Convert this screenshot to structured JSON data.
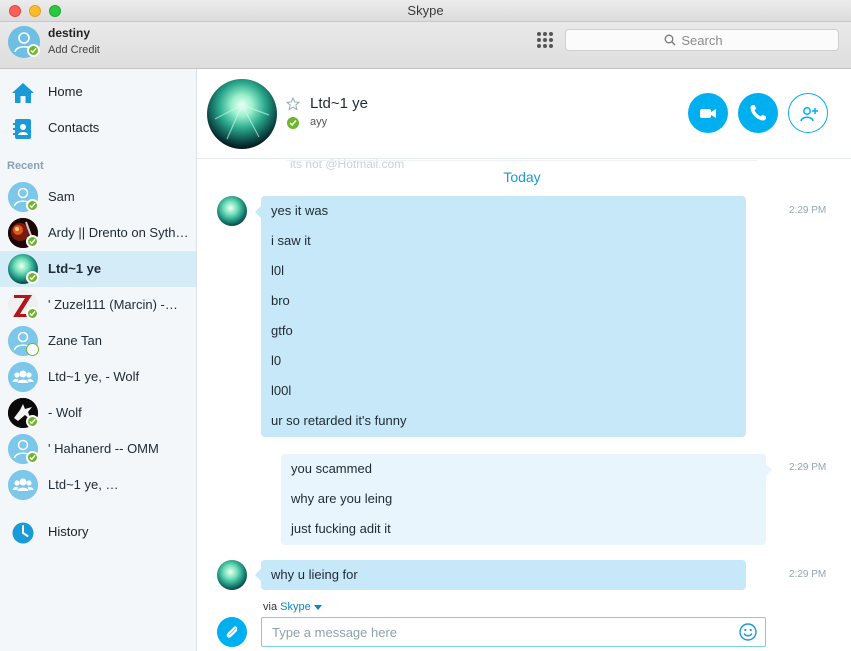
{
  "window": {
    "title": "Skype"
  },
  "account": {
    "name": "destiny",
    "credit_label": "Add Credit"
  },
  "search": {
    "placeholder": "Search"
  },
  "nav": {
    "home": "Home",
    "contacts": "Contacts",
    "history": "History"
  },
  "recent": {
    "label": "Recent",
    "contacts": [
      {
        "name": "Sam",
        "avatar": "default-user",
        "status": "online"
      },
      {
        "name": "Ardy || Drento on Sythe ||",
        "avatar": "photo-red",
        "status": "online"
      },
      {
        "name": "Ltd~1 ye",
        "avatar": "photo-teal",
        "status": "online",
        "selected": true
      },
      {
        "name": "' Zuzel111 (Marcin) -…",
        "avatar": "photo-z-logo",
        "status": "online"
      },
      {
        "name": "Zane Tan",
        "avatar": "default-user",
        "status": "offline"
      },
      {
        "name": "Ltd~1 ye, - Wolf",
        "avatar": "group",
        "status": "none"
      },
      {
        "name": "- Wolf",
        "avatar": "photo-wolf",
        "status": "online"
      },
      {
        "name": "' Hahanerd -- OMM",
        "avatar": "default-user",
        "status": "online"
      },
      {
        "name": "Ltd~1 ye, …",
        "avatar": "group",
        "status": "none"
      }
    ]
  },
  "conversation": {
    "contact_name": "Ltd~1 ye",
    "mood": "ayy",
    "faded_note": "its not @Hotmail.com",
    "day_label": "Today",
    "messages": [
      {
        "direction": "in",
        "time": "2:29 PM",
        "lines": [
          "yes it was",
          "i saw it",
          "l0l",
          "bro",
          "gtfo",
          "l0",
          "l00l",
          "ur so retarded it's funny"
        ]
      },
      {
        "direction": "out",
        "time": "2:29 PM",
        "lines": [
          "you scammed",
          "why are you leing",
          "just fucking adit it"
        ]
      },
      {
        "direction": "in",
        "time": "2:29 PM",
        "lines": [
          "why u lieing for"
        ]
      }
    ],
    "via_prefix": "via",
    "via_link": "Skype",
    "composer_placeholder": "Type a message here"
  },
  "colors": {
    "accent": "#00aff0",
    "online": "#6fb52c",
    "bubble_in": "#c6e8f8",
    "bubble_out": "#e8f5fc",
    "selected_row": "#d4ebf8"
  }
}
